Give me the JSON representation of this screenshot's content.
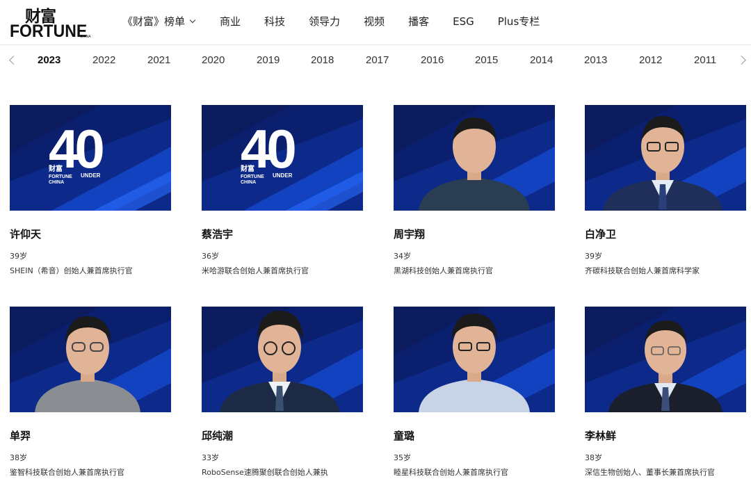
{
  "brand": {
    "logo_cn": "财富",
    "logo_en": "FORTUNE",
    "logo_sub": "CHINA"
  },
  "nav": {
    "items": [
      {
        "label": "《财富》榜单",
        "has_dropdown": true
      },
      {
        "label": "商业"
      },
      {
        "label": "科技"
      },
      {
        "label": "领导力"
      },
      {
        "label": "视频"
      },
      {
        "label": "播客"
      },
      {
        "label": "ESG"
      },
      {
        "label": "Plus专栏"
      }
    ]
  },
  "years": {
    "active": "2023",
    "items": [
      "2023",
      "2022",
      "2021",
      "2020",
      "2019",
      "2018",
      "2017",
      "2016",
      "2015",
      "2014",
      "2013",
      "2012",
      "2011"
    ]
  },
  "badge": {
    "number": "40",
    "under": "UNDER",
    "cn": "财富",
    "en": "FORTUNE",
    "sub": "CHINA"
  },
  "people": [
    {
      "name": "许仰天",
      "age": "39岁",
      "title": "SHEIN（希音）创始人兼首席执行官",
      "image": "40-under-40-logo"
    },
    {
      "name": "蔡浩宇",
      "age": "36岁",
      "title": "米哈游联合创始人兼首席执行官",
      "image": "40-under-40-logo"
    },
    {
      "name": "周宇翔",
      "age": "34岁",
      "title": "黑湖科技创始人兼首席执行官",
      "image": "portrait",
      "shirt": "#2a3d52"
    },
    {
      "name": "白净卫",
      "age": "39岁",
      "title": "齐碳科技联合创始人兼首席科学家",
      "image": "portrait",
      "shirt": "#1f2f5a"
    },
    {
      "name": "单羿",
      "age": "38岁",
      "title": "鉴智科技联合创始人兼首席执行官",
      "image": "portrait",
      "shirt": "#8a8d92"
    },
    {
      "name": "邱纯潮",
      "age": "33岁",
      "title": "RoboSense速腾聚创联合创始人兼执",
      "image": "portrait",
      "shirt": "#1c2a45"
    },
    {
      "name": "童璐",
      "age": "35岁",
      "title": "睦星科技联合创始人兼首席执行官",
      "image": "portrait",
      "shirt": "#c9d3e6"
    },
    {
      "name": "李林鲜",
      "age": "38岁",
      "title": "深信生物创始人、董事长兼首席执行官",
      "image": "portrait",
      "shirt": "#1a1f2b"
    }
  ],
  "colors": {
    "card_bg_dark": "#0a1f6e",
    "card_bg_bright": "#1a55e0",
    "stripe": "#2a6cff"
  }
}
